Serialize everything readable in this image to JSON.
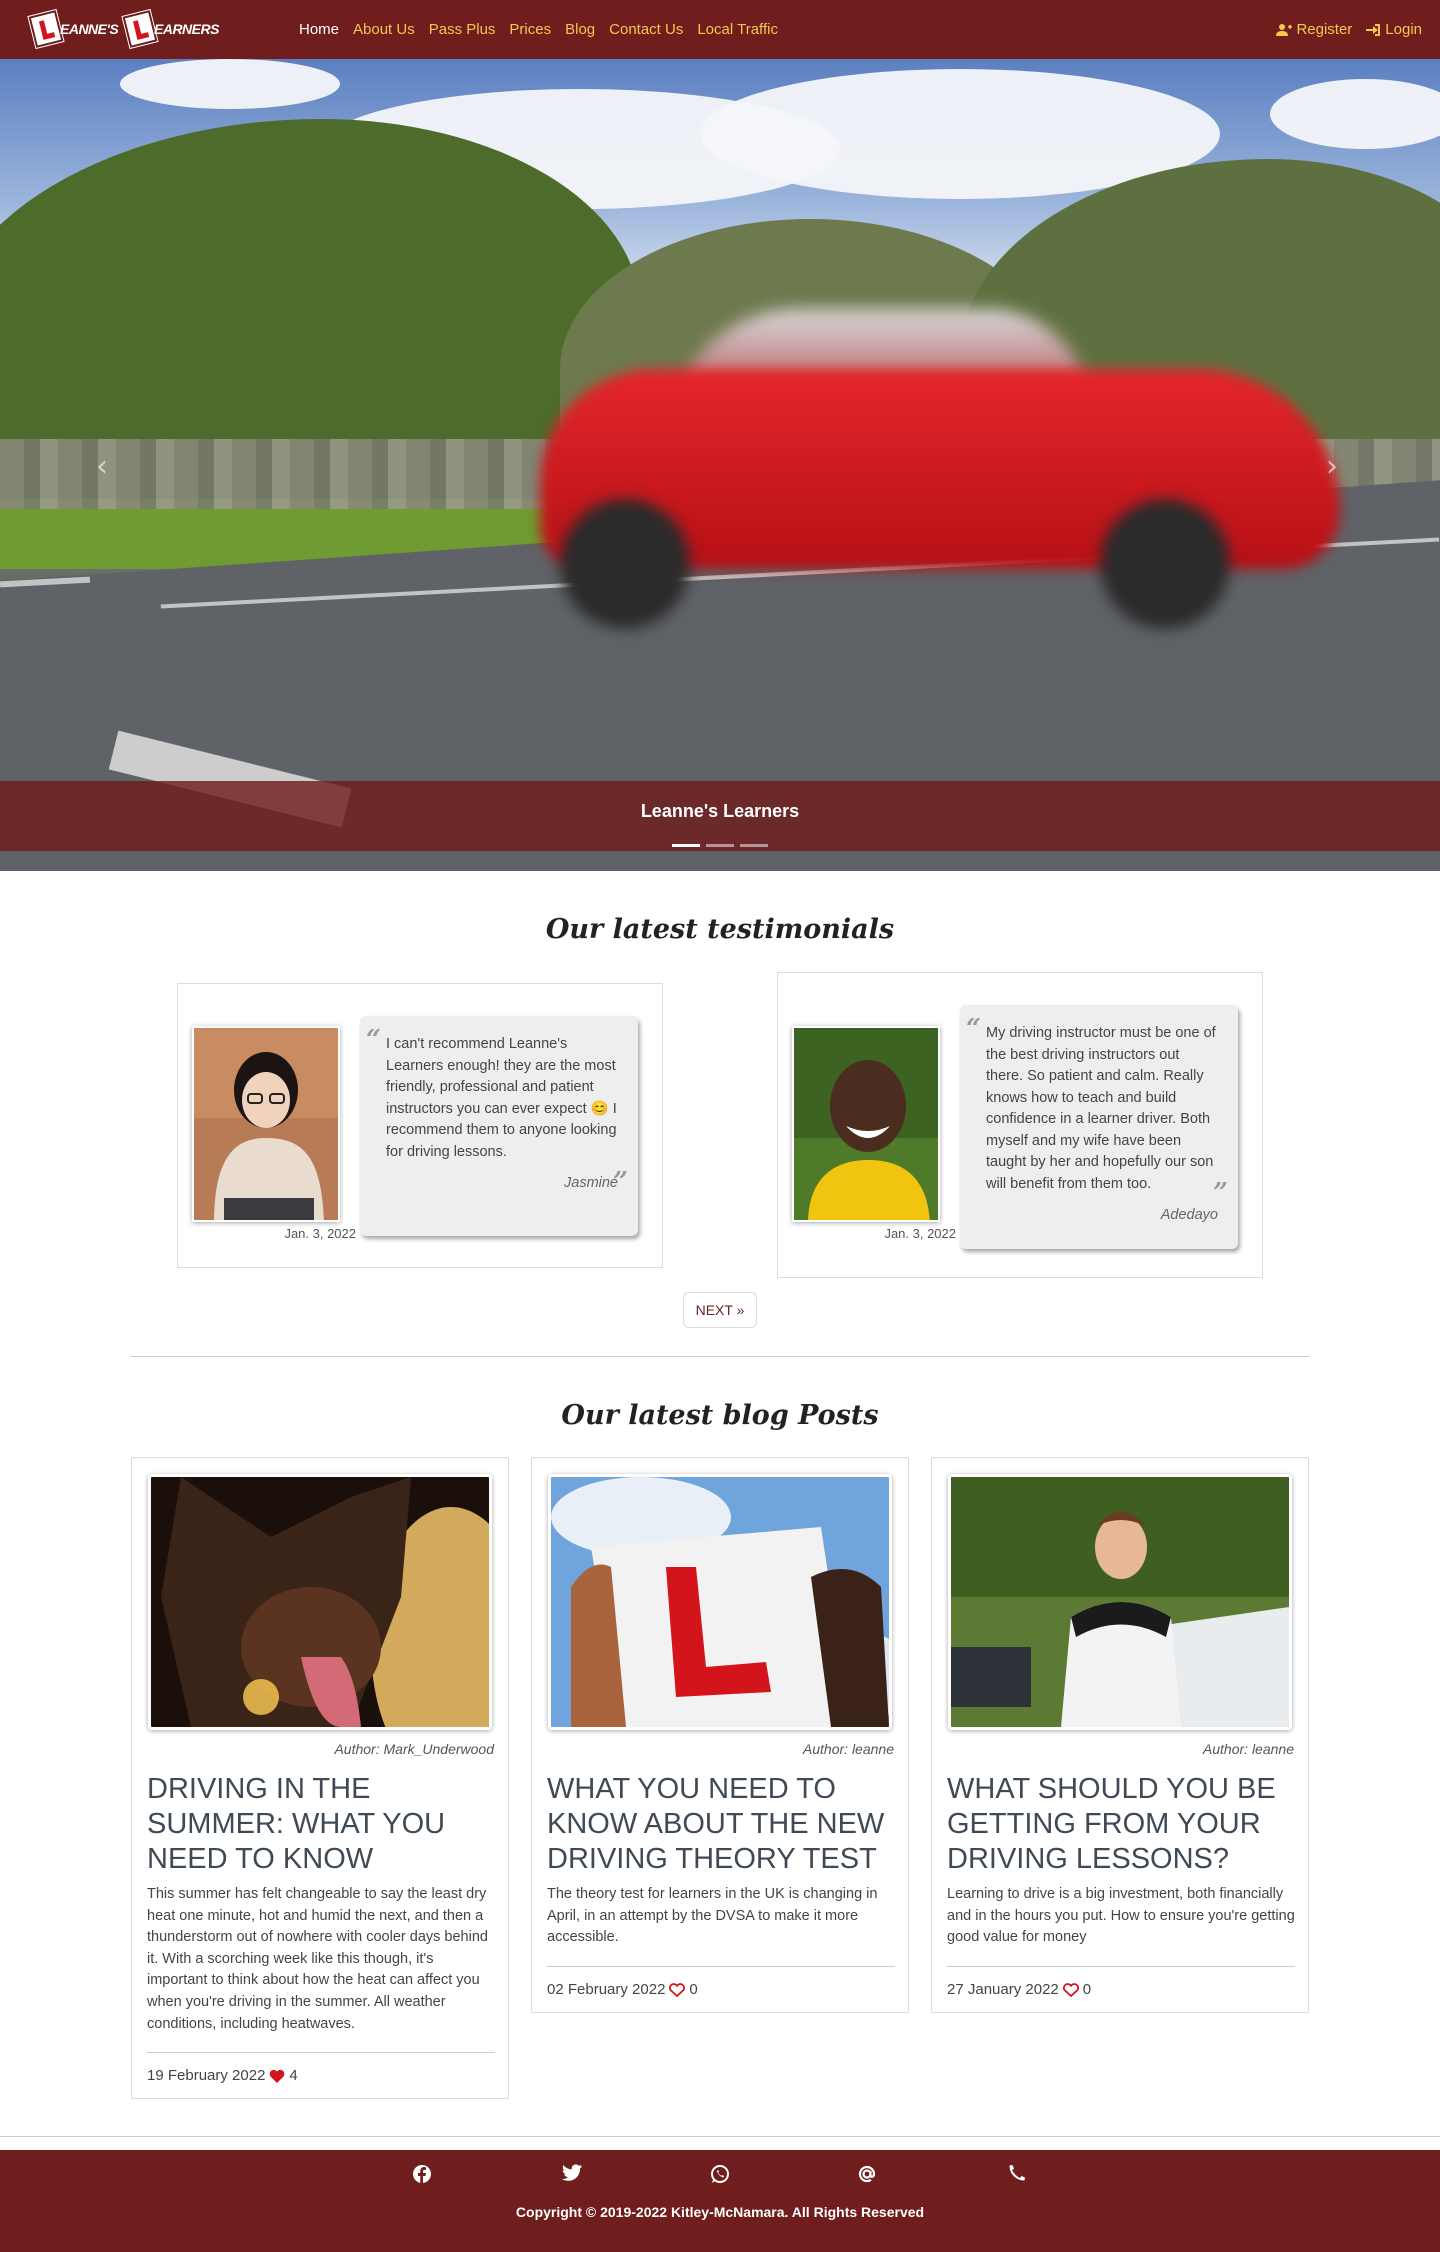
{
  "nav": {
    "brand_part1": "EANNE'S",
    "brand_part2": "EARNERS",
    "links": [
      "Home",
      "About Us",
      "Pass Plus",
      "Prices",
      "Blog",
      "Contact Us",
      "Local Traffic"
    ],
    "active": "Home",
    "register": "Register",
    "login": "Login"
  },
  "hero": {
    "caption": "Leanne's Learners",
    "prev_icon": "chevron-left-icon",
    "next_icon": "chevron-right-icon",
    "slides": 3,
    "active_slide": 1
  },
  "testimonials": {
    "title": "Our latest testimonials",
    "items": [
      {
        "text": "I can't recommend Leanne's Learners enough! they are the most friendly, professional and patient instructors you can ever expect 😊 I recommend them to anyone looking for driving lessons.",
        "author": "Jasmine",
        "date": "Jan. 3, 2022"
      },
      {
        "text": "My driving instructor must be one of the best driving instructors out there. So patient and calm. Really knows how to teach and build confidence in a learner driver. Both myself and my wife have been taught by her and hopefully our son will benefit from them too.",
        "author": "Adedayo",
        "date": "Jan. 3, 2022"
      }
    ],
    "next_label": "NEXT »"
  },
  "blog": {
    "title": "Our latest blog Posts",
    "posts": [
      {
        "author": "Author: Mark_Underwood",
        "title": "DRIVING IN THE SUMMER: WHAT YOU NEED TO KNOW",
        "excerpt": "This summer has felt changeable to say the least dry heat one minute, hot and humid the next, and then a thunderstorm out of nowhere with cooler days behind it. With a scorching week like this though, it's important to think about how the heat can affect you when you're driving in the summer. All weather conditions, including heatwaves.",
        "date": "19 February 2022",
        "likes": "4",
        "liked": true
      },
      {
        "author": "Author: leanne",
        "title": "WHAT YOU NEED TO KNOW ABOUT THE NEW DRIVING THEORY TEST",
        "excerpt": "The theory test for learners in the UK is changing in April, in an attempt by the DVSA to make it more accessible.",
        "date": "02 February 2022",
        "likes": "0",
        "liked": false
      },
      {
        "author": "Author: leanne",
        "title": "WHAT SHOULD YOU BE GETTING FROM YOUR DRIVING LESSONS?",
        "excerpt": "Learning to drive is a big investment, both financially and in the hours you put. How to ensure you're getting good value for money",
        "date": "27 January 2022",
        "likes": "0",
        "liked": false
      }
    ]
  },
  "footer": {
    "icons": [
      "facebook-icon",
      "twitter-icon",
      "whatsapp-icon",
      "email-icon",
      "phone-icon"
    ],
    "copyright": "Copyright © 2019-2022 Kitley-McNamara. All Rights Reserved"
  },
  "colors": {
    "brand": "#6f1d1d",
    "nav_link": "#f2c94c",
    "heart": "#d3141b"
  }
}
